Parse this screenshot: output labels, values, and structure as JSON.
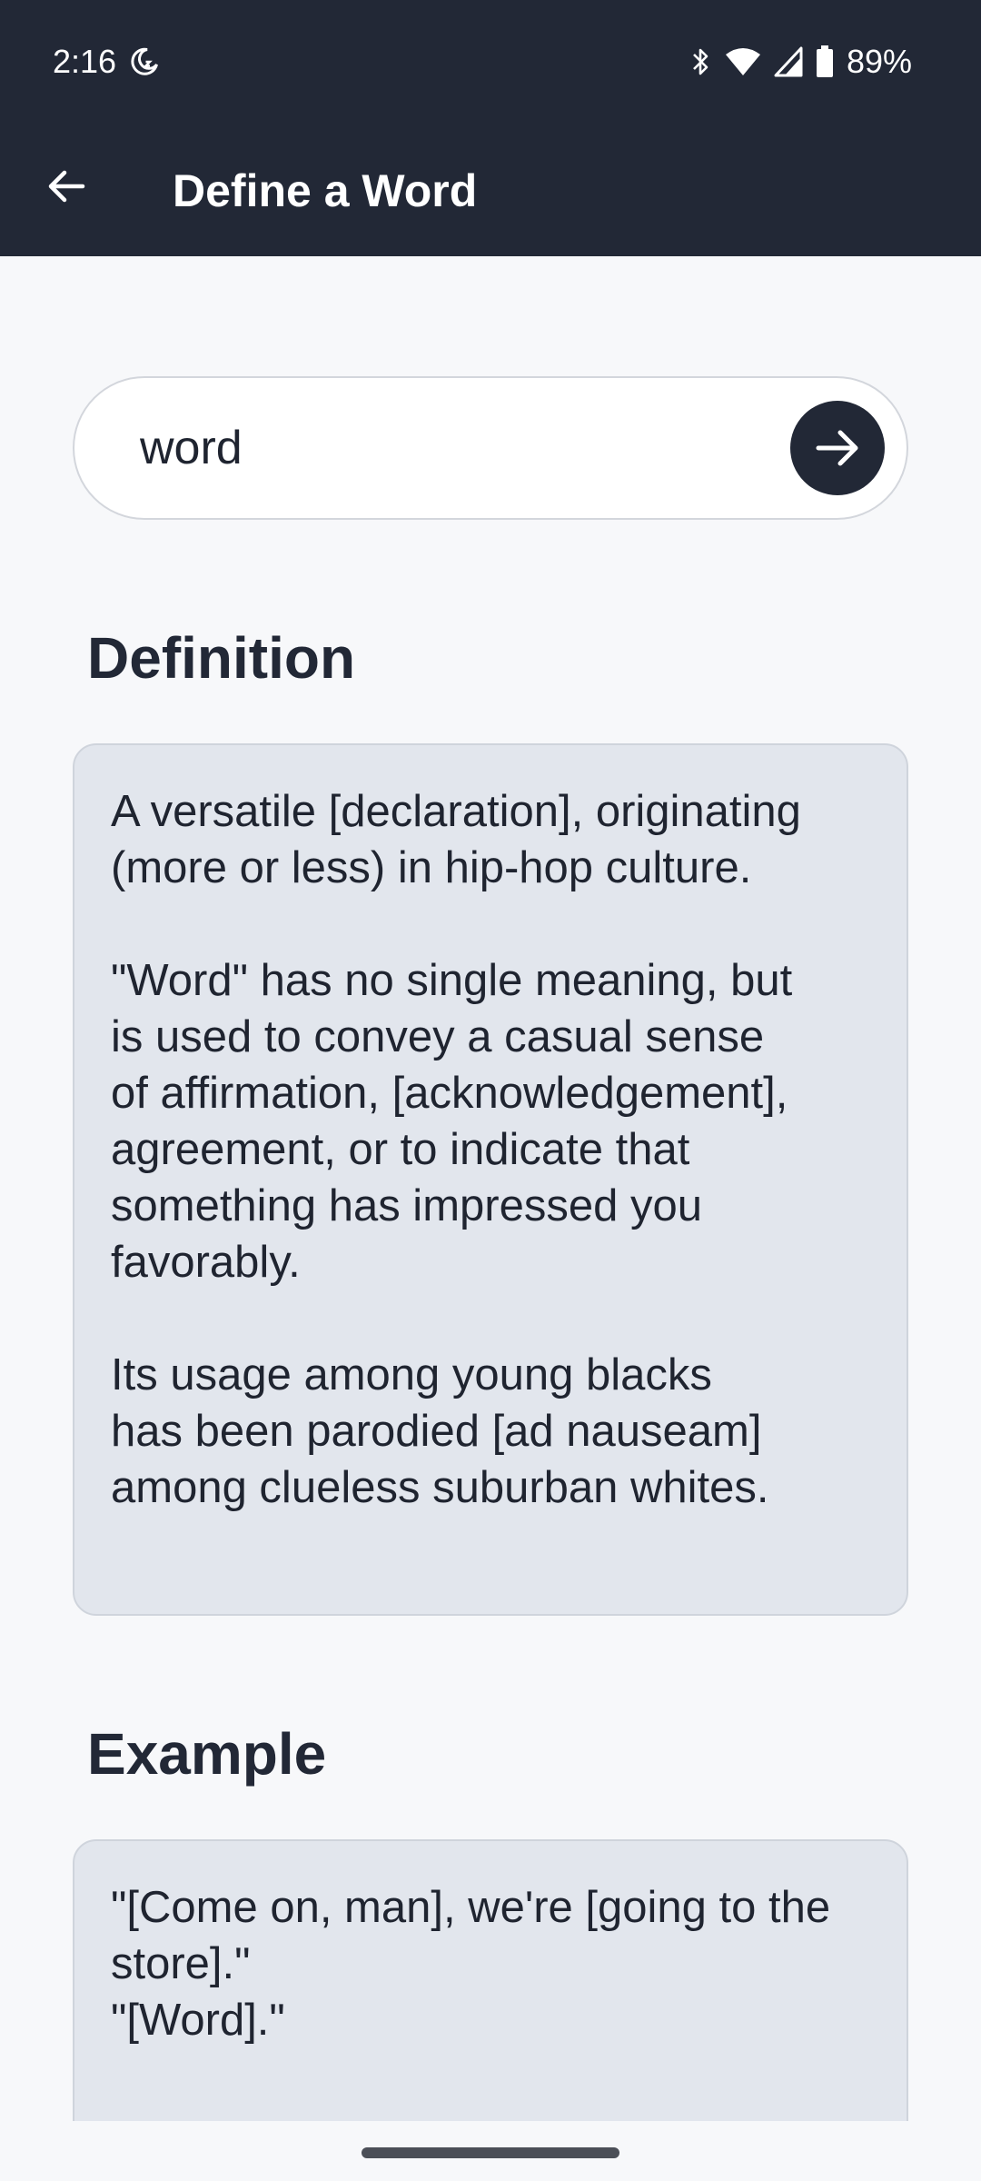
{
  "status_bar": {
    "time": "2:16",
    "battery": "89%"
  },
  "app_bar": {
    "title": "Define a Word"
  },
  "search": {
    "value": "word"
  },
  "definition": {
    "heading": "Definition",
    "paragraphs": [
      [
        "A versatile [declaration], originating",
        "(more or less) in hip-hop culture."
      ],
      [
        "\"Word\" has no single meaning, but",
        "is used to convey a casual sense",
        "of affirmation, [acknowledgement],",
        "agreement, or to indicate that",
        "something has impressed you",
        "favorably."
      ],
      [
        "Its usage among young blacks",
        "has been parodied [ad nauseam]",
        "among clueless suburban whites."
      ]
    ]
  },
  "example": {
    "heading": "Example",
    "lines": [
      "\"[Come on, man], we're [going to the",
      "store].\"",
      "\"[Word].\""
    ]
  },
  "icons": {
    "back": "arrow-left-icon",
    "go": "arrow-right-icon",
    "dnd": "moon-icon",
    "bluetooth": "bluetooth-icon",
    "wifi": "wifi-icon",
    "signal": "signal-icon",
    "battery": "battery-icon"
  },
  "colors": {
    "app_bar": "#222836",
    "background": "#f7f8fa",
    "card": "#e2e6ed",
    "text": "#1f2430"
  }
}
